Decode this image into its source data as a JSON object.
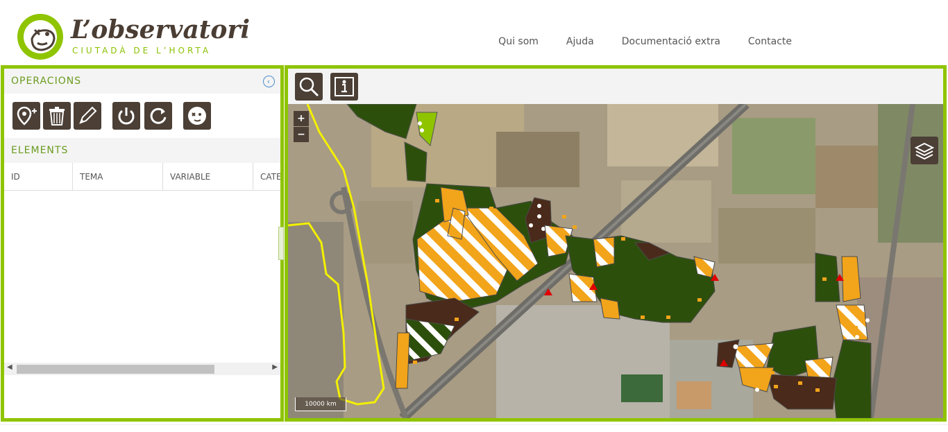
{
  "brand": {
    "title": "L’observatori",
    "subtitle": "CIUTADÀ DE L’HORTA",
    "colors": {
      "green": "#8fc400",
      "brown": "#4b3f36"
    }
  },
  "nav": {
    "items": [
      "Qui som",
      "Ajuda",
      "Documentació extra",
      "Contacte"
    ]
  },
  "left_panel": {
    "operacions_title": "OPERACIONS",
    "elements_title": "ELEMENTS",
    "tools": [
      "add-point-icon",
      "trash-icon",
      "pencil-icon",
      "power-icon",
      "refresh-icon",
      "observatori-logo-icon"
    ],
    "table_headers": [
      "ID",
      "TEMA",
      "VARIABLE",
      "CATE"
    ]
  },
  "map": {
    "toolbar": [
      "search-icon",
      "info-icon"
    ],
    "zoom_in": "+",
    "zoom_out": "−",
    "scale_label": "10000 km"
  }
}
